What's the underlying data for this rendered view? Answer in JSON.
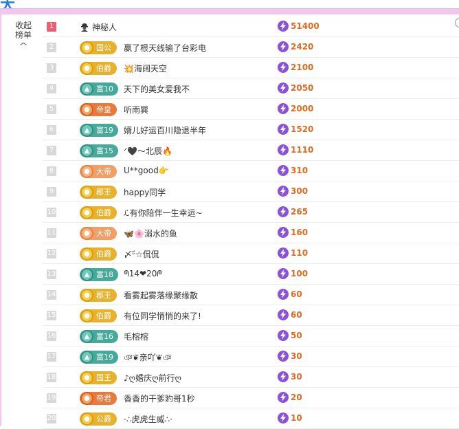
{
  "corner_glyph": "大",
  "collapse": {
    "line1": "收起",
    "line2": "榜单",
    "chevron": "^"
  },
  "rows": [
    {
      "rank": "1",
      "badge": null,
      "badge_color": null,
      "name": "神秘人",
      "amount": "51400"
    },
    {
      "rank": "2",
      "badge": "国公",
      "badge_color": "gold",
      "name": "赢了根天线输了台彩电",
      "amount": "2420"
    },
    {
      "rank": "3",
      "badge": "伯爵",
      "badge_color": "gold",
      "name": "💥海阔天空",
      "amount": "2100"
    },
    {
      "rank": "4",
      "badge": "富10",
      "badge_color": "teal",
      "name": "天下的美女爱我不",
      "amount": "2050"
    },
    {
      "rank": "5",
      "badge": "帝皇",
      "badge_color": "orange",
      "name": "听雨巽",
      "amount": "2000"
    },
    {
      "rank": "6",
      "badge": "富19",
      "badge_color": "teal",
      "name": "婿儿好运百川隐退半年",
      "amount": "1520"
    },
    {
      "rank": "7",
      "badge": "富15",
      "badge_color": "teal",
      "name": "ᐟ🖤～北辰🔥",
      "amount": "1110"
    },
    {
      "rank": "8",
      "badge": "大帝",
      "badge_color": "fire",
      "name": "U**good👉",
      "amount": "310"
    },
    {
      "rank": "9",
      "badge": "郡王",
      "badge_color": "gold",
      "name": "happy同学",
      "amount": "300"
    },
    {
      "rank": "10",
      "badge": "伯爵",
      "badge_color": "gold",
      "name": "ℒ有你陪伴一生幸运~",
      "amount": "265"
    },
    {
      "rank": "11",
      "badge": "大帝",
      "badge_color": "fire",
      "name": "🦋🌸溺水的鱼",
      "amount": "160"
    },
    {
      "rank": "12",
      "badge": "伯爵",
      "badge_color": "gold",
      "name": "〆ᵕ᷄☆侃侃",
      "amount": "110"
    },
    {
      "rank": "13",
      "badge": "富18",
      "badge_color": "teal",
      "name": "ᖗ14❤20ᖘ",
      "amount": "100"
    },
    {
      "rank": "14",
      "badge": "郡王",
      "badge_color": "gold",
      "name": "看雾起雾落缘聚缘散",
      "amount": "60"
    },
    {
      "rank": "15",
      "badge": "伯爵",
      "badge_color": "gold",
      "name": "有位同学悄悄的来了!",
      "amount": "60"
    },
    {
      "rank": "16",
      "badge": "富16",
      "badge_color": "teal",
      "name": "毛榕榕",
      "amount": "50"
    },
    {
      "rank": "17",
      "badge": "富19",
      "badge_color": "teal",
      "name": "ঞ❦亲吖❦ঞ",
      "amount": "30"
    },
    {
      "rank": "18",
      "badge": "国王",
      "badge_color": "gold",
      "name": "♪ღ婚庆ღ前行ღ",
      "amount": "30"
    },
    {
      "rank": "19",
      "badge": "帝君",
      "badge_color": "orange",
      "name": "香香的干爹豹哥1秒",
      "amount": "20"
    },
    {
      "rank": "20",
      "badge": "公爵",
      "badge_color": "gold",
      "name": "·∴虎虎生威∴·",
      "amount": "10"
    }
  ],
  "colors": {
    "top_rank": "#e9616e",
    "rank_default": "#d8d8d8",
    "gold": "#e8b12c",
    "teal": "#45a99b",
    "orange": "#ea7a3c",
    "amount": "#e06b1f",
    "bolt": "#8b52d8",
    "strip": "#f2c7ee"
  },
  "icons": {
    "gift": "lightning-bolt-icon",
    "mystery": "mystery-person-icon"
  }
}
